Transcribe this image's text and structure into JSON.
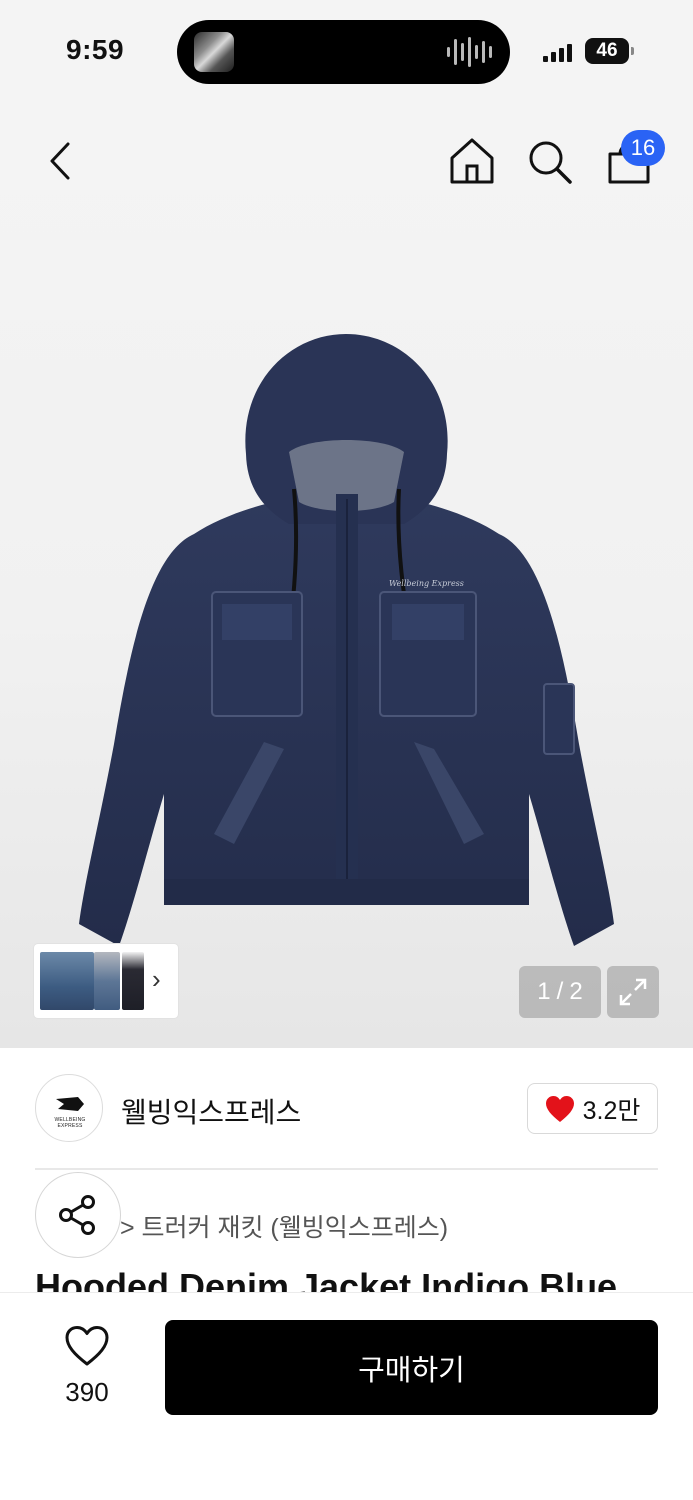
{
  "status_bar": {
    "time": "9:59",
    "battery": "46",
    "icons": [
      "now-playing-artwork",
      "audio-waveform-icon",
      "signal-icon",
      "battery-icon"
    ]
  },
  "nav": {
    "icons": [
      "back-chevron-icon",
      "home-icon",
      "search-icon",
      "shopping-bag-icon"
    ],
    "cart_count": "16"
  },
  "gallery": {
    "current": "1",
    "separator": "/",
    "total": "2",
    "icons": [
      "expand-icon",
      "chevron-right-icon"
    ]
  },
  "brand": {
    "name": "웰빙익스프레스",
    "logo_text": "WELLBEING EXPRESS",
    "like_count": "3.2만",
    "like_color": "#e3121a"
  },
  "product": {
    "breadcrumb": "> 트러커 재킷 (웰빙익스프레스)",
    "title": "Hooded Denim Jacket Indigo Blue"
  },
  "bottom": {
    "wish_count": "390",
    "buy_label": "구매하기"
  },
  "colors": {
    "badge": "#2a63f5",
    "buy_button": "#000000",
    "denim": "#2b3556"
  }
}
